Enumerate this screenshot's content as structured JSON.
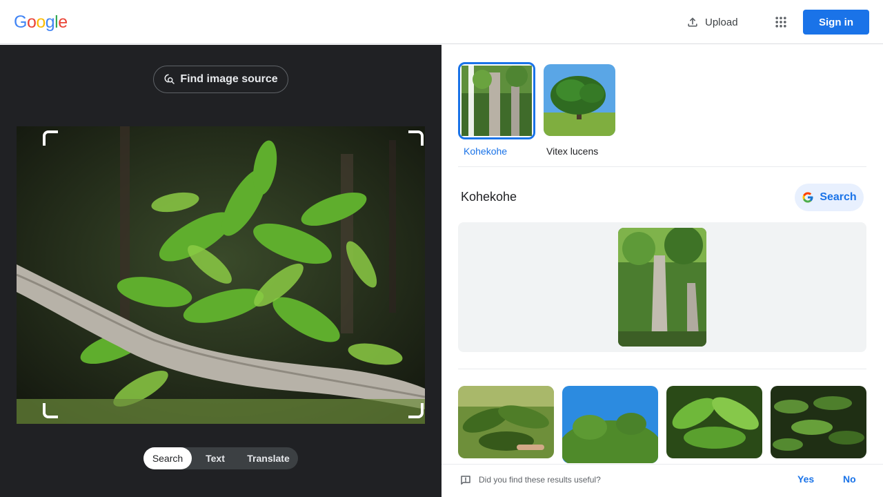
{
  "header": {
    "logo_letters": [
      {
        "char": "G",
        "color": "#4285F4"
      },
      {
        "char": "o",
        "color": "#EA4335"
      },
      {
        "char": "o",
        "color": "#FBBC05"
      },
      {
        "char": "g",
        "color": "#4285F4"
      },
      {
        "char": "l",
        "color": "#34A853"
      },
      {
        "char": "e",
        "color": "#EA4335"
      }
    ],
    "upload_label": "Upload",
    "upload_icon": "upload-icon",
    "apps_icon": "apps-grid-icon",
    "signin_label": "Sign in",
    "accent": "#1a73e8"
  },
  "left": {
    "find_source_label": "Find image source",
    "find_source_icon": "lens-search-icon",
    "modes": [
      {
        "label": "Search",
        "active": true
      },
      {
        "label": "Text",
        "active": false
      },
      {
        "label": "Translate",
        "active": false
      }
    ]
  },
  "right": {
    "entities": [
      {
        "label": "Kohekohe",
        "selected": true
      },
      {
        "label": "Vitex lucens",
        "selected": false
      }
    ],
    "result_title": "Kohekohe",
    "search_button_label": "Search",
    "feedback": {
      "question": "Did you find these results useful?",
      "yes": "Yes",
      "no": "No",
      "icon": "feedback-icon"
    }
  }
}
